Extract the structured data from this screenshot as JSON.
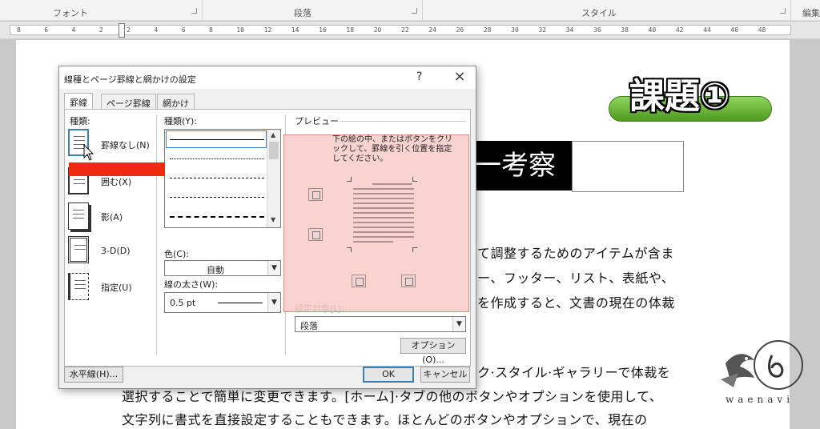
{
  "ribbon": {
    "groups": [
      {
        "label": "フォント"
      },
      {
        "label": "段落"
      },
      {
        "label": "スタイル"
      },
      {
        "label": "編集"
      }
    ]
  },
  "ruler": {
    "ticks": [
      "8",
      "6",
      "4",
      "2",
      "2",
      "4",
      "6",
      "8",
      "10",
      "12",
      "14",
      "16",
      "18",
      "20",
      "22",
      "24",
      "26",
      "28",
      "30",
      "32",
      "34",
      "36",
      "38",
      "40",
      "42",
      "44",
      "46",
      "48"
    ]
  },
  "document": {
    "badge": "課題①",
    "title_text": "一考察",
    "body_lines": [
      "て調整するためのアイテムが含ま",
      "ー、フッター、リスト、表紙や、",
      "を作成すると、文書の現在の体裁",
      "ク·スタイル·ギャラリーで体裁を",
      "選択することで簡単に変更できます。[ホーム]·タブの他のボタンやオプションを使用して、",
      "文字列に書式を直接設定することもできます。ほとんどのボタンやオプションで、現在の"
    ],
    "logo_text": "waenavi"
  },
  "dialog": {
    "title": "線種とページ罫線と網かけの設定",
    "help_label": "?",
    "close_label": "×",
    "tabs": [
      {
        "label": "罫線",
        "active": true
      },
      {
        "label": "ページ罫線",
        "active": false
      },
      {
        "label": "網かけ",
        "active": false
      }
    ],
    "type_section_label": "種類:",
    "settings": [
      {
        "label": "罫線なし(N)",
        "icon": "no-border-icon",
        "selected": true
      },
      {
        "label": "囲む(X)",
        "icon": "box-border-icon",
        "selected": false
      },
      {
        "label": "影(A)",
        "icon": "shadow-border-icon",
        "selected": false
      },
      {
        "label": "3-D(D)",
        "icon": "3d-border-icon",
        "selected": false
      },
      {
        "label": "指定(U)",
        "icon": "custom-border-icon",
        "selected": false
      }
    ],
    "style_label": "種類(Y):",
    "color_label": "色(C):",
    "color_value": "自動",
    "width_label": "線の太さ(W):",
    "width_value": "0.5 pt",
    "preview_label": "プレビュー",
    "preview_help": "下の絵の中、またはボタンをクリックして、罫線を引く位置を指定してください。",
    "apply_label": "設定対象(L):",
    "apply_value": "段落",
    "options_button": "オプション(O)...",
    "horizontal_line_button": "水平線(H)...",
    "ok_button": "OK",
    "cancel_button": "キャンセル"
  },
  "colors": {
    "highlight_bar": "#ee2b10",
    "preview_overlay": "#f8cdc8",
    "badge_green": "#5cae2a"
  }
}
